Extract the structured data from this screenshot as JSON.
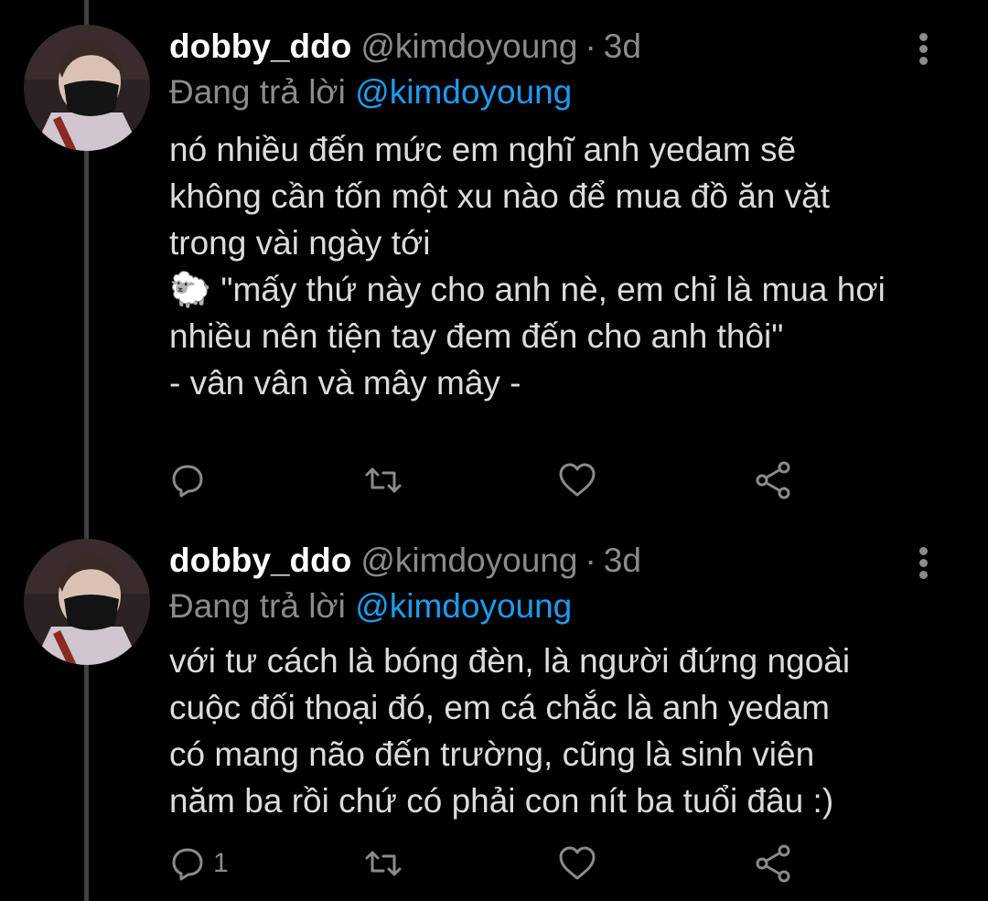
{
  "colors": {
    "background": "#000000",
    "text_primary": "#ffffff",
    "text_body": "#dcdcdc",
    "text_secondary": "#8b8b8b",
    "mention": "#1d9bf0",
    "thread_line": "#3d4044"
  },
  "tweets": [
    {
      "display_name": "dobby_ddo",
      "handle": "@kimdoyoung",
      "separator": "·",
      "time": "3d",
      "replying_prefix": "Đang trả lời",
      "replying_to": "@kimdoyoung",
      "body_lines": [
        "nó nhiều đến mức em nghĩ anh yedam sẽ",
        "không cần tốn một xu nào để mua đồ ăn vặt",
        "trong vài ngày tới",
        "🐑 \"mấy thứ này cho anh nè, em chỉ là mua hơi",
        "nhiều nên tiện tay đem đến cho anh thôi\"",
        "- vân vân và mây mây -"
      ],
      "reply_count": "",
      "icons": [
        "avatar",
        "more-vertical-icon",
        "reply-icon",
        "retweet-icon",
        "like-icon",
        "share-icon"
      ]
    },
    {
      "display_name": "dobby_ddo",
      "handle": "@kimdoyoung",
      "separator": "·",
      "time": "3d",
      "replying_prefix": "Đang trả lời",
      "replying_to": "@kimdoyoung",
      "body_lines": [
        "với tư cách là bóng đèn, là người đứng ngoài",
        "cuộc đối thoại đó, em cá chắc là anh yedam",
        "có mang não đến trường, cũng là sinh viên",
        "năm ba rồi chứ có phải con nít ba tuổi đâu :)"
      ],
      "reply_count": "1",
      "icons": [
        "avatar",
        "more-vertical-icon",
        "reply-icon",
        "retweet-icon",
        "like-icon",
        "share-icon"
      ]
    }
  ]
}
